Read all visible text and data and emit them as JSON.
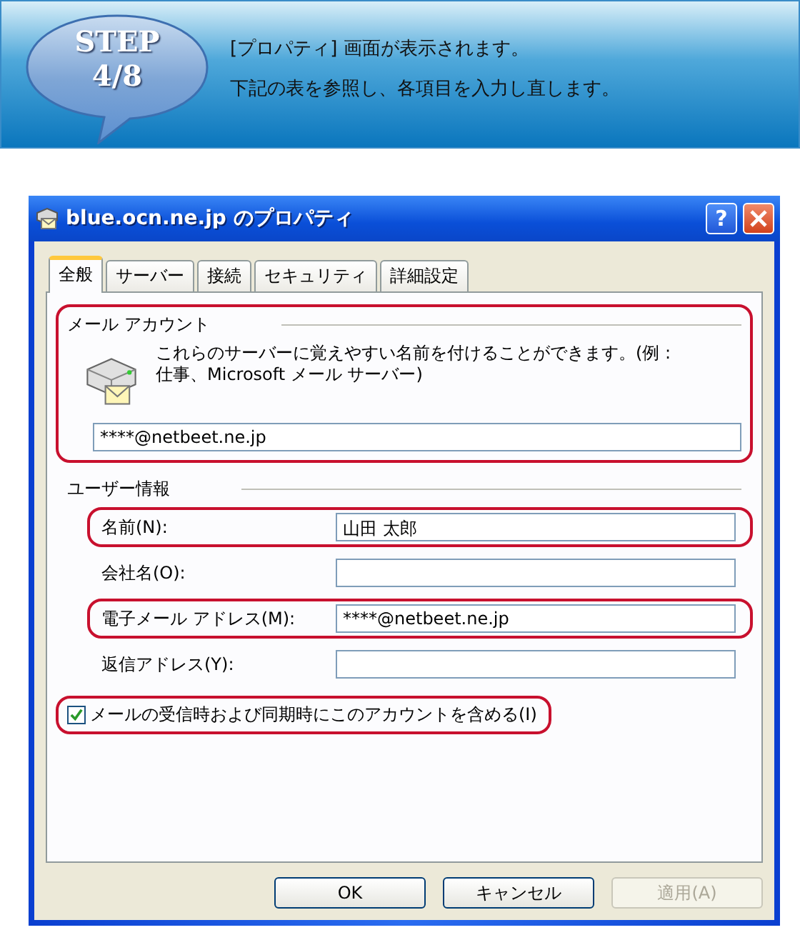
{
  "banner": {
    "step_label": "STEP",
    "step_number": "4/8",
    "lines": [
      "[プロパティ] 画面が表示されます。",
      "下記の表を参照し、各項目を入力し直します。"
    ]
  },
  "window": {
    "title": "blue.ocn.ne.jp のプロパティ",
    "help": "?"
  },
  "tabs": [
    {
      "label": "全般",
      "selected": true
    },
    {
      "label": "サーバー",
      "selected": false
    },
    {
      "label": "接続",
      "selected": false
    },
    {
      "label": "セキュリティ",
      "selected": false
    },
    {
      "label": "詳細設定",
      "selected": false
    }
  ],
  "mail_account": {
    "heading": "メール アカウント",
    "highlighted": true,
    "description": "これらのサーバーに覚えやすい名前を付けることができます。(例 : 仕事、Microsoft メール サーバー)",
    "value": "****@netbeet.ne.jp"
  },
  "user_info": {
    "heading": "ユーザー情報",
    "fields": [
      {
        "label": "名前(N):",
        "value": "山田 太郎",
        "highlighted": true
      },
      {
        "label": "会社名(O):",
        "highlighted": false
      },
      {
        "label": "電子メール アドレス(M):",
        "value": "****@netbeet.ne.jp",
        "highlighted": true
      },
      {
        "label": "返信アドレス(Y):",
        "highlighted": false
      }
    ]
  },
  "include_account": {
    "label": "メールの受信時および同期時にこのアカウントを含める(I)",
    "checked": true,
    "highlighted": true
  },
  "buttons": [
    {
      "label": "OK",
      "disabled": false
    },
    {
      "label": "キャンセル",
      "disabled": false
    },
    {
      "label": "適用(A)",
      "disabled": true
    }
  ]
}
